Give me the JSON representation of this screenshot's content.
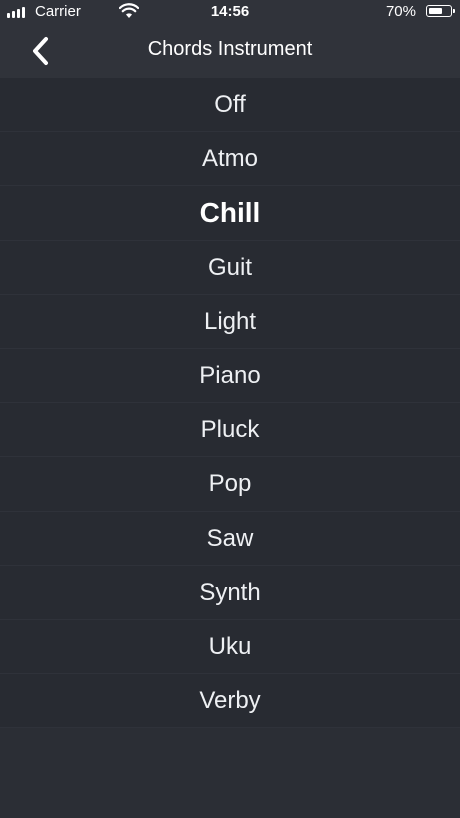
{
  "status_bar": {
    "carrier": "Carrier",
    "time": "14:56",
    "battery_percent": "70%",
    "battery_level": 0.7,
    "icons": [
      "signal-icon",
      "wifi-icon",
      "battery-icon"
    ]
  },
  "nav": {
    "title": "Chords Instrument",
    "back_icon": "chevron-left-icon"
  },
  "instruments": [
    "Off",
    "Atmo",
    "Chill",
    "Guit",
    "Light",
    "Piano",
    "Pluck",
    "Pop",
    "Saw",
    "Synth",
    "Uku",
    "Verby"
  ],
  "selected_index": 2,
  "colors": {
    "background": "#2b2e35",
    "nav_background": "#30333a",
    "row_background": "#282b32",
    "text": "#ffffff"
  }
}
